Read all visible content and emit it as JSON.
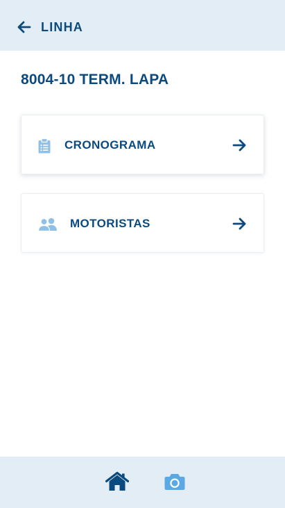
{
  "header": {
    "back_label": "LINHA",
    "back_icon": "arrow-left-icon"
  },
  "page": {
    "title": "8004-10 TERM. LAPA"
  },
  "menu": {
    "items": [
      {
        "label": "CRONOGRAMA",
        "icon": "clipboard-list-icon",
        "chevron": "arrow-right-icon"
      },
      {
        "label": "MOTORISTAS",
        "icon": "users-icon",
        "chevron": "arrow-right-icon"
      }
    ]
  },
  "bottom_nav": {
    "items": [
      {
        "icon": "home-icon",
        "active": true
      },
      {
        "icon": "camera-icon",
        "active": false
      }
    ]
  },
  "colors": {
    "primary": "#0b4a7f",
    "icon_light": "#8fc1e8",
    "bar_bg": "#e3edf6",
    "camera": "#5aa8e4"
  }
}
